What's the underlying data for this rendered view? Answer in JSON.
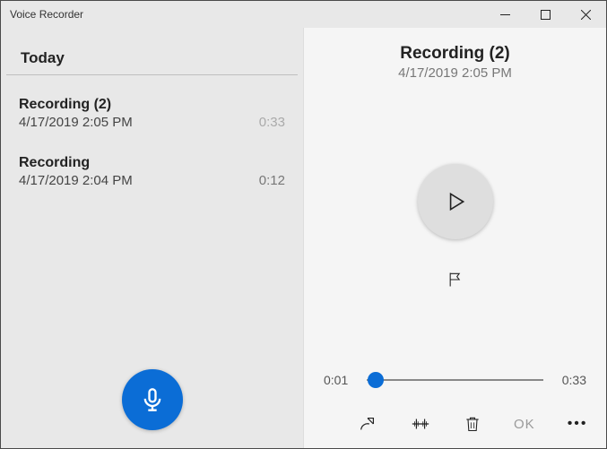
{
  "window": {
    "title": "Voice Recorder"
  },
  "sidebar": {
    "section": "Today",
    "recordings": [
      {
        "title": "Recording (2)",
        "timestamp": "4/17/2019 2:05 PM",
        "duration": "0:33",
        "selected": true
      },
      {
        "title": "Recording",
        "timestamp": "4/17/2019 2:04 PM",
        "duration": "0:12",
        "selected": false
      }
    ]
  },
  "details": {
    "title": "Recording (2)",
    "timestamp": "4/17/2019 2:05 PM",
    "elapsed": "0:01",
    "total": "0:33",
    "progress_pct": 5,
    "rename": "OK"
  }
}
